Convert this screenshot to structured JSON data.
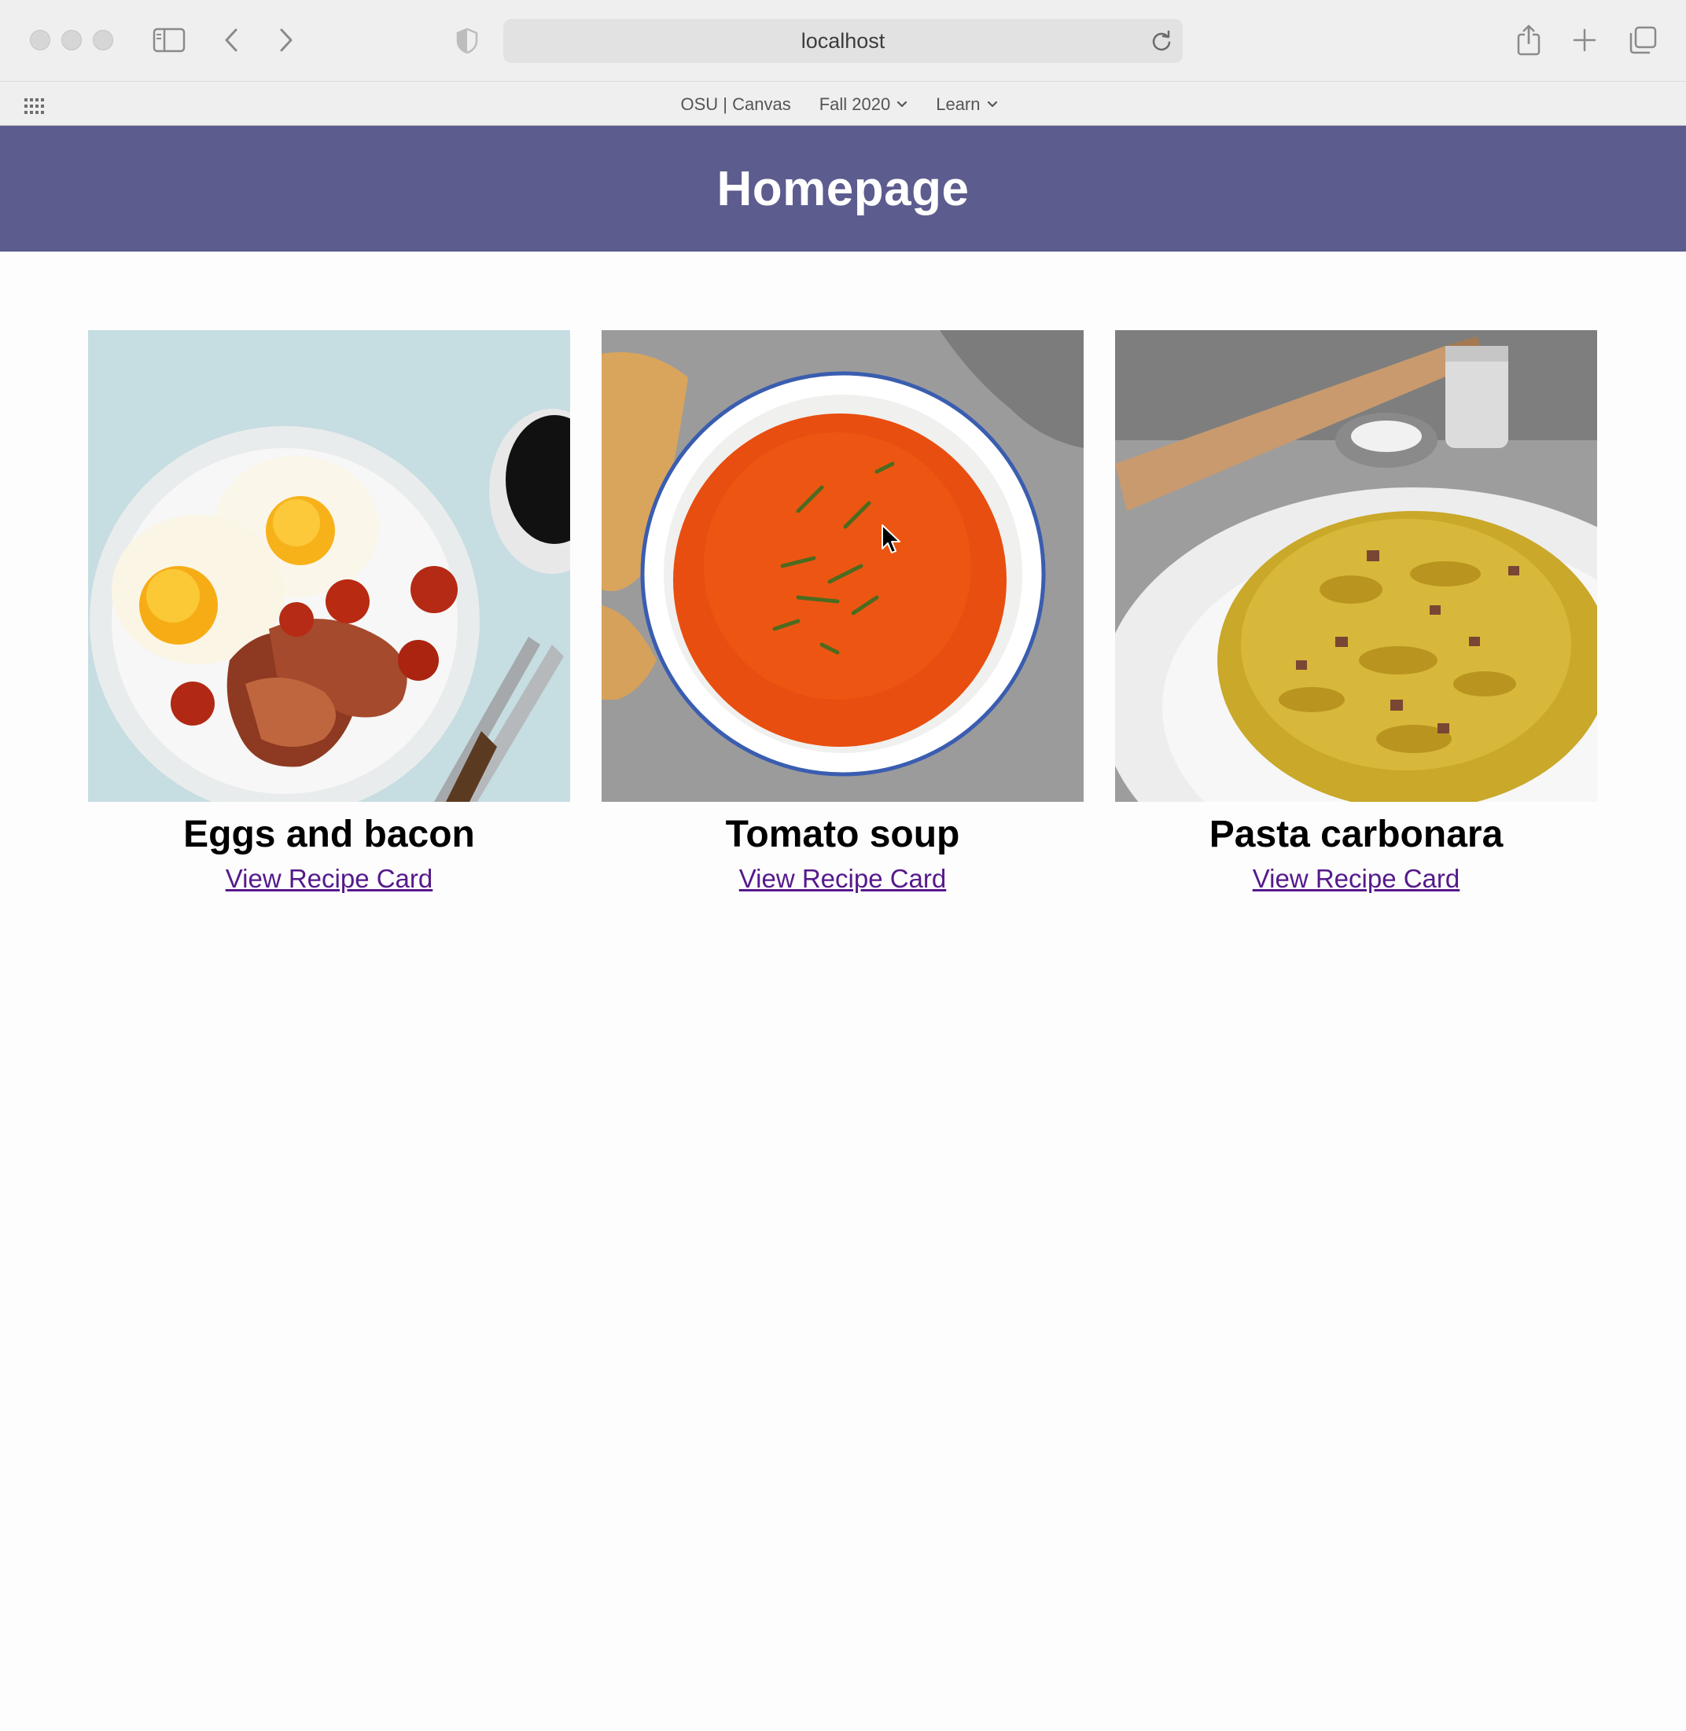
{
  "browser": {
    "url": "localhost",
    "favorites": [
      {
        "label": "OSU | Canvas",
        "has_menu": false
      },
      {
        "label": "Fall 2020",
        "has_menu": true
      },
      {
        "label": "Learn",
        "has_menu": true
      }
    ]
  },
  "page": {
    "title": "Homepage",
    "header_color": "#5c5c8f",
    "link_color": "#551a8b",
    "recipes": [
      {
        "name": "Eggs and bacon",
        "link": "View Recipe Card"
      },
      {
        "name": "Tomato soup",
        "link": "View Recipe Card"
      },
      {
        "name": "Pasta carbonara",
        "link": "View Recipe Card"
      }
    ]
  }
}
